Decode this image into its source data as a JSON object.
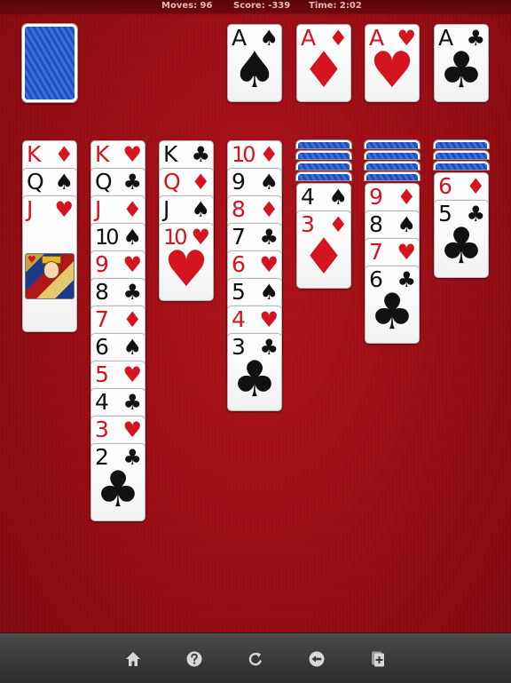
{
  "status": {
    "moves": "Moves: 96",
    "score": "Score: -339",
    "time": "Time: 2:02"
  },
  "colors": {
    "felt": "#9a0d14",
    "red_suit": "#d4141e",
    "black_suit": "#111111",
    "card_back": "#2a5cc8",
    "toolbar": "#3a3a3a"
  },
  "stock": {
    "face_down": true
  },
  "foundations": [
    {
      "rank": "A",
      "suit": "♠",
      "color": "black"
    },
    {
      "rank": "A",
      "suit": "♦",
      "color": "red"
    },
    {
      "rank": "A",
      "suit": "♥",
      "color": "red"
    },
    {
      "rank": "A",
      "suit": "♣",
      "color": "black"
    }
  ],
  "tableau": [
    {
      "hidden": 0,
      "cards": [
        {
          "rank": "K",
          "suit": "♦",
          "color": "red"
        },
        {
          "rank": "Q",
          "suit": "♠",
          "color": "black"
        },
        {
          "rank": "J",
          "suit": "♥",
          "color": "red"
        }
      ]
    },
    {
      "hidden": 0,
      "cards": [
        {
          "rank": "K",
          "suit": "♥",
          "color": "red"
        },
        {
          "rank": "Q",
          "suit": "♣",
          "color": "black"
        },
        {
          "rank": "J",
          "suit": "♦",
          "color": "red"
        },
        {
          "rank": "10",
          "suit": "♠",
          "color": "black"
        },
        {
          "rank": "9",
          "suit": "♥",
          "color": "red"
        },
        {
          "rank": "8",
          "suit": "♣",
          "color": "black"
        },
        {
          "rank": "7",
          "suit": "♦",
          "color": "red"
        },
        {
          "rank": "6",
          "suit": "♠",
          "color": "black"
        },
        {
          "rank": "5",
          "suit": "♥",
          "color": "red"
        },
        {
          "rank": "4",
          "suit": "♣",
          "color": "black"
        },
        {
          "rank": "3",
          "suit": "♥",
          "color": "red"
        },
        {
          "rank": "2",
          "suit": "♣",
          "color": "black"
        }
      ]
    },
    {
      "hidden": 0,
      "cards": [
        {
          "rank": "K",
          "suit": "♣",
          "color": "black"
        },
        {
          "rank": "Q",
          "suit": "♦",
          "color": "red"
        },
        {
          "rank": "J",
          "suit": "♠",
          "color": "black"
        },
        {
          "rank": "10",
          "suit": "♥",
          "color": "red"
        }
      ]
    },
    {
      "hidden": 0,
      "cards": [
        {
          "rank": "10",
          "suit": "♦",
          "color": "red"
        },
        {
          "rank": "9",
          "suit": "♠",
          "color": "black"
        },
        {
          "rank": "8",
          "suit": "♦",
          "color": "red"
        },
        {
          "rank": "7",
          "suit": "♣",
          "color": "black"
        },
        {
          "rank": "6",
          "suit": "♥",
          "color": "red"
        },
        {
          "rank": "5",
          "suit": "♠",
          "color": "black"
        },
        {
          "rank": "4",
          "suit": "♥",
          "color": "red"
        },
        {
          "rank": "3",
          "suit": "♣",
          "color": "black"
        }
      ]
    },
    {
      "hidden": 4,
      "cards": [
        {
          "rank": "4",
          "suit": "♠",
          "color": "black"
        },
        {
          "rank": "3",
          "suit": "♦",
          "color": "red"
        }
      ]
    },
    {
      "hidden": 4,
      "cards": [
        {
          "rank": "9",
          "suit": "♦",
          "color": "red"
        },
        {
          "rank": "8",
          "suit": "♠",
          "color": "black"
        },
        {
          "rank": "7",
          "suit": "♥",
          "color": "red"
        },
        {
          "rank": "6",
          "suit": "♣",
          "color": "black"
        }
      ]
    },
    {
      "hidden": 3,
      "cards": [
        {
          "rank": "6",
          "suit": "♦",
          "color": "red"
        },
        {
          "rank": "5",
          "suit": "♣",
          "color": "black"
        }
      ]
    }
  ],
  "toolbar": [
    {
      "name": "home-button",
      "icon": "home-icon"
    },
    {
      "name": "help-button",
      "icon": "help-icon"
    },
    {
      "name": "restart-button",
      "icon": "restart-icon"
    },
    {
      "name": "undo-button",
      "icon": "undo-icon"
    },
    {
      "name": "new-game-button",
      "icon": "new-deal-icon"
    }
  ]
}
